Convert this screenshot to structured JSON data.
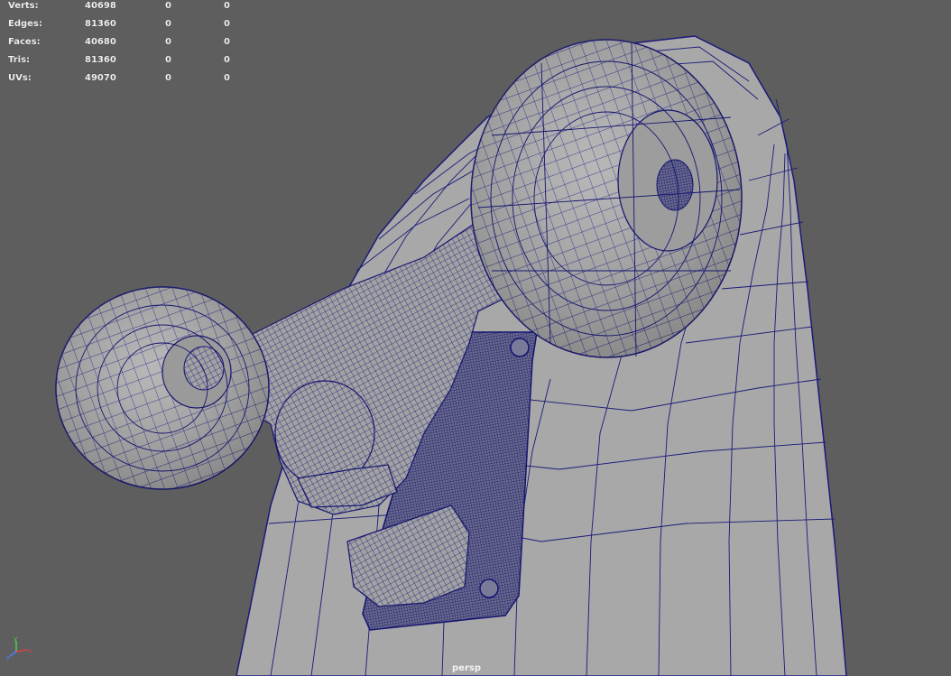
{
  "hud": {
    "rows": [
      {
        "label": "Verts:",
        "v1": "40698",
        "v2": "0",
        "v3": "0"
      },
      {
        "label": "Edges:",
        "v1": "81360",
        "v2": "0",
        "v3": "0"
      },
      {
        "label": "Faces:",
        "v1": "40680",
        "v2": "0",
        "v3": "0"
      },
      {
        "label": "Tris:",
        "v1": "81360",
        "v2": "0",
        "v3": "0"
      },
      {
        "label": "UVs:",
        "v1": "49070",
        "v2": "0",
        "v3": "0"
      }
    ]
  },
  "viewport": {
    "camera": "persp",
    "background": "#5e5e5e",
    "wire_color": "#1a1a7a",
    "surface_color": "#a6a6a6"
  },
  "axis": {
    "x": "x",
    "y": "y",
    "z": "z"
  }
}
